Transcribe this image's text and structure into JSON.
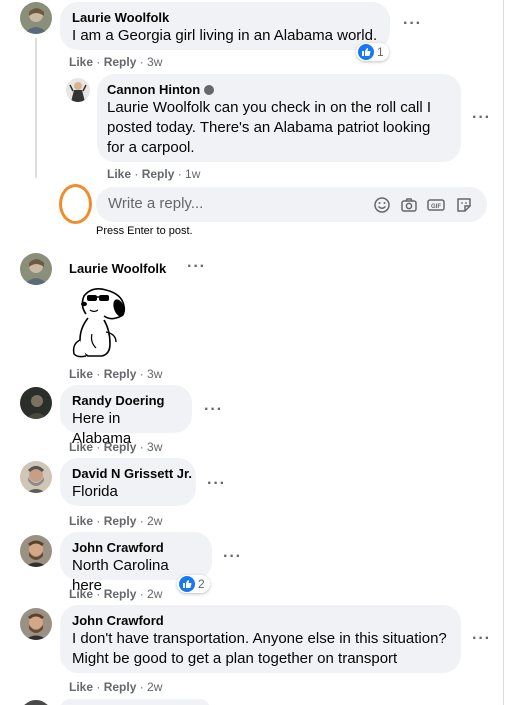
{
  "comments": [
    {
      "name": "Laurie Woolfolk",
      "text": "I am a Georgia girl living in an Alabama world.",
      "like": "Like",
      "reply": "Reply",
      "time": "3w",
      "reactions": "1"
    },
    {
      "name": "Cannon Hinton",
      "text": "Laurie Woolfolk can you check in on the roll call I posted today. There's an Alabama patriot looking for a carpool.",
      "like": "Like",
      "reply": "Reply",
      "time": "1w"
    },
    {
      "name": "Laurie Woolfolk",
      "sticker": "snoopy-sunglasses-sticker",
      "like": "Like",
      "reply": "Reply",
      "time": "3w"
    },
    {
      "name": "Randy Doering",
      "text": "Here in Alabama",
      "like": "Like",
      "reply": "Reply",
      "time": "3w"
    },
    {
      "name": "David N Grissett Jr.",
      "text": "Florida",
      "like": "Like",
      "reply": "Reply",
      "time": "2w"
    },
    {
      "name": "John Crawford",
      "text": "North Carolina here",
      "like": "Like",
      "reply": "Reply",
      "time": "2w",
      "reactions": "2"
    },
    {
      "name": "John Crawford",
      "text": "I don't have transportation. Anyone else in this situation? Might be good to get a plan together on transport",
      "like": "Like",
      "reply": "Reply",
      "time": "2w"
    }
  ],
  "reply_box": {
    "placeholder": "Write a reply...",
    "hint": "Press Enter to post.",
    "icons": [
      "emoji-icon",
      "camera-icon",
      "gif-icon",
      "sticker-icon"
    ]
  },
  "colors": {
    "bubble": "#f0f2f5",
    "meta": "#65676b",
    "like_blue": "#1877f2",
    "highlight_ring": "#f28c28"
  }
}
